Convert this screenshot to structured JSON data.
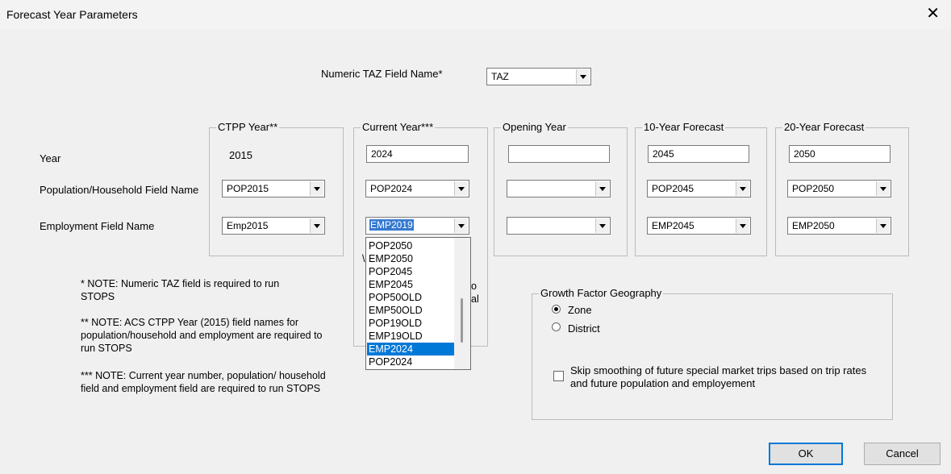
{
  "window": {
    "title": "Forecast Year Parameters",
    "close_glyph": "✕"
  },
  "taz": {
    "label": "Numeric TAZ Field Name*",
    "value": "TAZ"
  },
  "row_labels": {
    "year": "Year",
    "population": "Population/Household Field Name",
    "employment": "Employment Field Name"
  },
  "groups": {
    "ctpp": {
      "title": "CTPP Year**",
      "year": "2015",
      "population": "POP2015",
      "employment": "Emp2015"
    },
    "current": {
      "title": "Current Year***",
      "year": "2024",
      "population": "POP2024",
      "employment": "EMP2019"
    },
    "opening": {
      "title": "Opening Year",
      "year": "",
      "population": "",
      "employment": ""
    },
    "ten": {
      "title": "10-Year Forecast",
      "year": "2045",
      "population": "POP2045",
      "employment": "EMP2045"
    },
    "twenty": {
      "title": "20-Year Forecast",
      "year": "2050",
      "population": "POP2050",
      "employment": "EMP2050"
    }
  },
  "dropdown": {
    "items": [
      "POP2050",
      "EMP2050",
      "POP2045",
      "EMP2045",
      "POP50OLD",
      "EMP50OLD",
      "POP19OLD",
      "EMP19OLD",
      "EMP2024",
      "POP2024"
    ],
    "highlighted": "EMP2024"
  },
  "notes": {
    "note1": "* NOTE: Numeric TAZ field is required to run STOPS",
    "note2": "** NOTE: ACS CTPP Year (2015) field names for population/household and employment are required to run STOPS",
    "note3": "*** NOTE: Current year number, population/ household field and employment field are required to run STOPS"
  },
  "growth": {
    "title": "Growth Factor Geography",
    "zone": "Zone",
    "district": "District",
    "selected": "Zone",
    "skip_smoothing": "Skip smoothing of future special market trips based on trip rates and future population and employement",
    "skip_checked": false
  },
  "buttons": {
    "ok": "OK",
    "cancel": "Cancel"
  }
}
